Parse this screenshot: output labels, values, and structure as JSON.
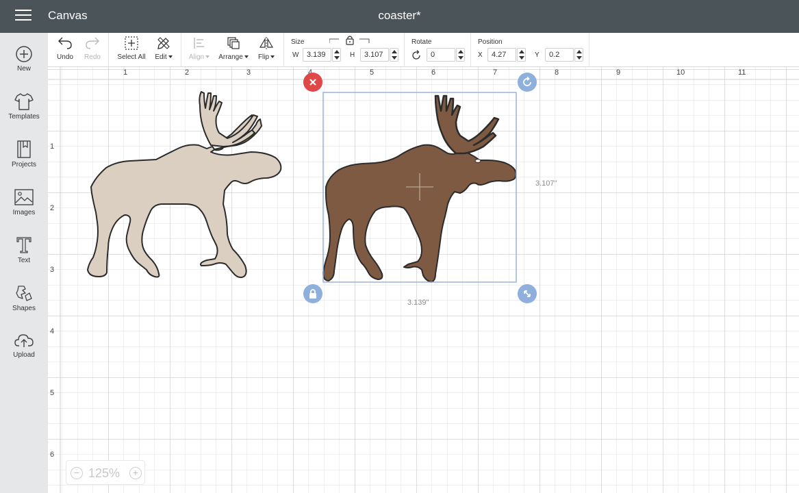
{
  "header": {
    "app_title": "Canvas",
    "doc_title": "coaster*"
  },
  "sidebar": {
    "items": [
      {
        "label": "New",
        "icon": "plus-circle-icon"
      },
      {
        "label": "Templates",
        "icon": "tshirt-icon"
      },
      {
        "label": "Projects",
        "icon": "notebook-icon"
      },
      {
        "label": "Images",
        "icon": "image-icon"
      },
      {
        "label": "Text",
        "icon": "text-icon"
      },
      {
        "label": "Shapes",
        "icon": "shapes-icon"
      },
      {
        "label": "Upload",
        "icon": "cloud-upload-icon"
      }
    ]
  },
  "toolbar": {
    "undo": "Undo",
    "redo": "Redo",
    "select_all": "Select All",
    "edit": "Edit",
    "align": "Align",
    "arrange": "Arrange",
    "flip": "Flip",
    "size_label": "Size",
    "w_label": "W",
    "w_value": "3.139",
    "h_label": "H",
    "h_value": "3.107",
    "rotate_label": "Rotate",
    "rotate_value": "0",
    "position_label": "Position",
    "x_label": "X",
    "x_value": "4.27",
    "y_label": "Y",
    "y_value": "0.2"
  },
  "canvas": {
    "ruler_top": [
      "1",
      "2",
      "3",
      "4",
      "5",
      "6",
      "7",
      "8",
      "9",
      "10",
      "11"
    ],
    "ruler_left": [
      "1",
      "2",
      "3",
      "4",
      "5",
      "6"
    ],
    "selection": {
      "height_label": "3.107\"",
      "width_label": "3.139\""
    },
    "shapes": [
      {
        "name": "moose",
        "fill": "#dbcfc2",
        "stroke": "#2b2b2b"
      },
      {
        "name": "moose",
        "fill": "#7d5a41",
        "stroke": "#2b2b2b"
      }
    ],
    "handle_colors": {
      "delete": "#e04848",
      "control": "#8fb0dc"
    }
  },
  "zoom": {
    "minus": "−",
    "plus": "+",
    "value": "125%"
  },
  "colors": {
    "header": "#4a5459",
    "sidebar": "#e6e7e8",
    "selection": "#9ab4d8"
  }
}
